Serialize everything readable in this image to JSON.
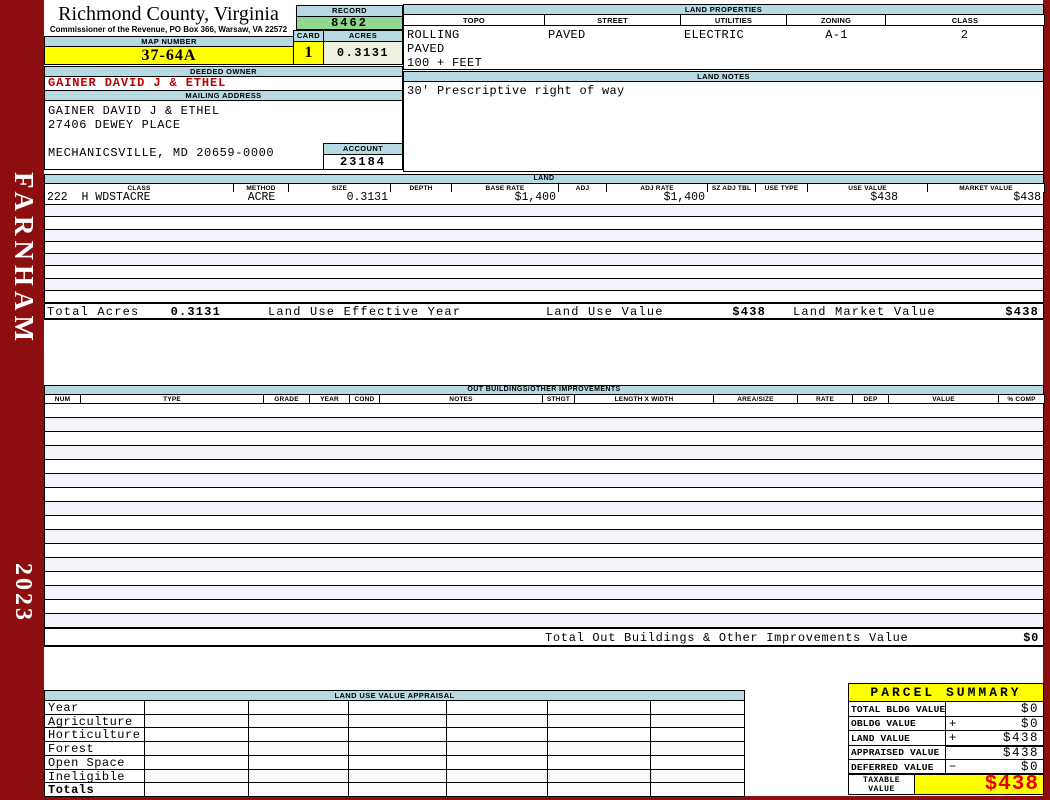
{
  "header": {
    "county_title": "Richmond County, Virginia",
    "commissioner_line": "Commissioner of the Revenue, PO Box 366, Warsaw, VA 22572"
  },
  "sidebar": {
    "district": "FARNHAM",
    "year": "2023"
  },
  "record": {
    "label": "RECORD",
    "value": "8462"
  },
  "map": {
    "label": "MAP NUMBER",
    "value": "37-64A"
  },
  "card": {
    "label": "CARD",
    "value": "1"
  },
  "acres": {
    "label": "ACRES",
    "value": "0.3131"
  },
  "land_properties": {
    "title": "LAND PROPERTIES",
    "columns": [
      "TOPO",
      "STREET",
      "UTILITIES",
      "ZONING",
      "CLASS"
    ],
    "values": [
      "ROLLING",
      "PAVED",
      "ELECTRIC",
      "A-1",
      "2"
    ],
    "extra_lines": [
      "PAVED",
      "100 + FEET"
    ]
  },
  "deeded_owner": {
    "title": "DEEDED OWNER",
    "value": "GAINER DAVID J & ETHEL"
  },
  "mailing_address": {
    "title": "MAILING ADDRESS",
    "lines": [
      "GAINER DAVID J & ETHEL",
      "27406 DEWEY PLACE",
      "MECHANICSVILLE, MD 20659-0000"
    ]
  },
  "account": {
    "label": "ACCOUNT",
    "value": "23184"
  },
  "land_notes": {
    "title": "LAND NOTES",
    "text": "30' Prescriptive right of way"
  },
  "land_table": {
    "title": "LAND",
    "columns": [
      "CLASS",
      "METHOD",
      "SIZE",
      "DEPTH",
      "BASE RATE",
      "ADJ",
      "ADJ RATE",
      "SZ ADJ TBL",
      "USE TYPE",
      "USE VALUE",
      "MARKET VALUE"
    ],
    "row_cells": [
      "222  H WDSTACRE",
      "ACRE",
      "0.3131",
      "",
      "$1,400",
      "",
      "$1,400",
      "",
      "",
      "$438",
      "$438"
    ],
    "empty_row_count": 8,
    "totals": {
      "total_acres_label": "Total Acres",
      "total_acres": "0.3131",
      "effective_year_label": "Land Use Effective Year",
      "use_value_label": "Land Use Value",
      "use_value": "$438",
      "market_value_label": "Land Market Value",
      "market_value": "$438"
    }
  },
  "out_buildings": {
    "title": "OUT BUILDINGS/OTHER IMPROVEMENTS",
    "columns": [
      "NUM",
      "TYPE",
      "GRADE",
      "YEAR",
      "COND",
      "NOTES",
      "STHGT",
      "LENGTH X WIDTH",
      "AREA/SIZE",
      "RATE",
      "DEP",
      "VALUE",
      "% COMP"
    ],
    "empty_row_count": 16,
    "total_label": "Total Out Buildings & Other Improvements Value",
    "total_value": "$0"
  },
  "land_use_appraisal": {
    "title": "LAND USE VALUE APPRAISAL",
    "row_labels": [
      "Year",
      "Agriculture",
      "Horticulture",
      "Forest",
      "Open Space",
      "Ineligible",
      "Totals"
    ],
    "column_count": 6
  },
  "parcel_summary": {
    "title": "PARCEL SUMMARY",
    "rows": [
      {
        "label": "TOTAL BLDG VALUE",
        "op": "",
        "value": "$0"
      },
      {
        "label": "OBLDG VALUE",
        "op": "+",
        "value": "$0"
      },
      {
        "label": "LAND VALUE",
        "op": "+",
        "value": "$438"
      },
      {
        "label": "APPRAISED VALUE",
        "op": "",
        "value": "$438"
      },
      {
        "label": "DEFERRED VALUE",
        "op": "−",
        "value": "$0"
      }
    ],
    "taxable": {
      "label": "TAXABLE VALUE",
      "value": "$438"
    }
  },
  "colors": {
    "frame_maroon": "#8D0E0E",
    "section_bar_blue": "#B7DAE2",
    "record_green": "#90D890",
    "highlight_yellow": "#FFFF00",
    "acres_cream": "#F0F0E0",
    "owner_red": "#C00000",
    "taxable_red": "#E80000"
  }
}
